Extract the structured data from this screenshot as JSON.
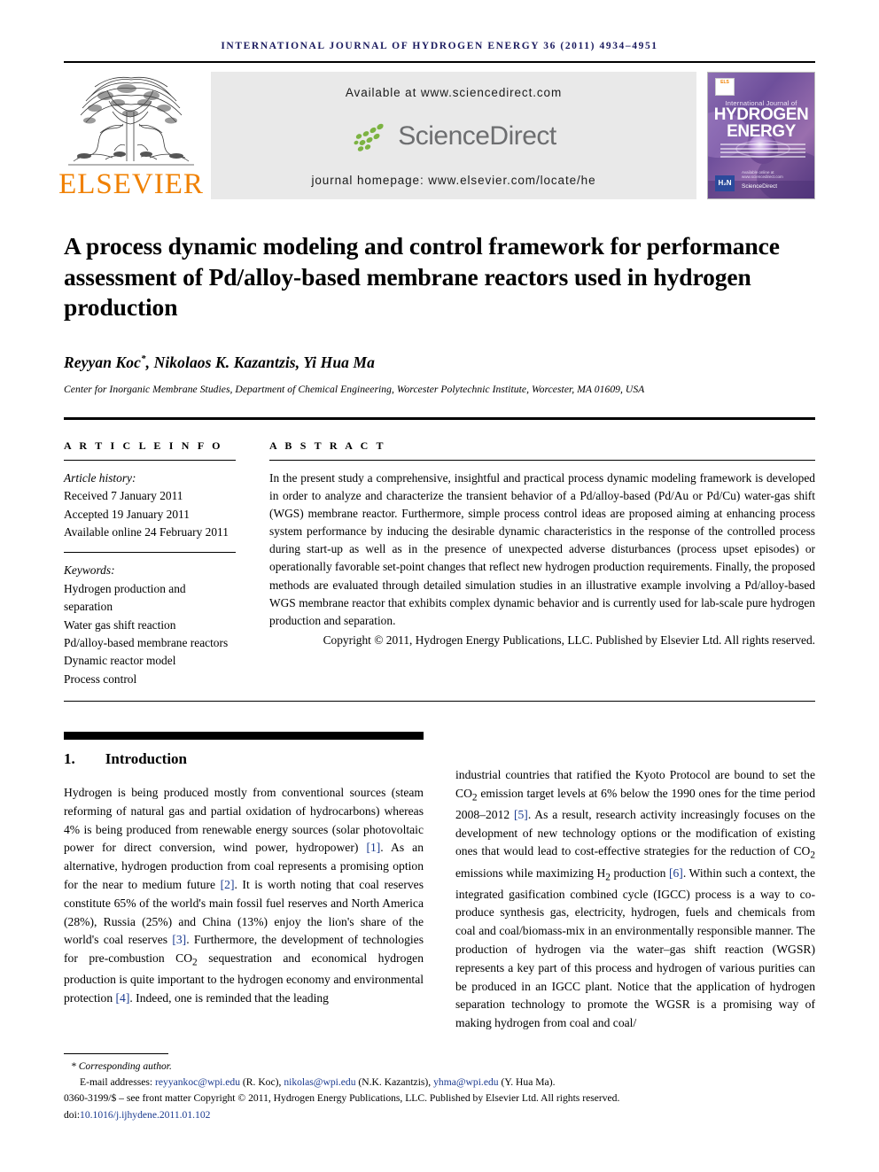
{
  "running_head": "international journal of hydrogen energy 36 (2011) 4934–4951",
  "masthead": {
    "publisher": "ELSEVIER",
    "available_at": "Available at www.sciencedirect.com",
    "sciencedirect_word": "ScienceDirect",
    "journal_homepage": "journal homepage: www.elsevier.com/locate/he",
    "cover": {
      "line_small": "International Journal of",
      "line_1": "HYDROGEN",
      "line_2": "ENERGY",
      "badge_hi": "H₂N",
      "sd_label": "ScienceDirect",
      "sd_sub": "Available online at www.sciencedirect.com"
    },
    "accent_orange": "#F08000",
    "accent_green": "#7CB342",
    "banner_bg": "#e9e9e9"
  },
  "article": {
    "title": "A process dynamic modeling and control framework for performance assessment of Pd/alloy-based membrane reactors used in hydrogen production",
    "authors": "Reyyan Koc",
    "authors_star": "*",
    "authors_rest": ", Nikolaos K. Kazantzis, Yi Hua Ma",
    "affiliation": "Center for Inorganic Membrane Studies, Department of Chemical Engineering, Worcester Polytechnic Institute, Worcester, MA 01609, USA"
  },
  "article_info": {
    "heading": "A R T I C L E   I N F O",
    "history_label": "Article history:",
    "received": "Received 7 January 2011",
    "accepted": "Accepted 19 January 2011",
    "available_online": "Available online 24 February 2011",
    "keywords_label": "Keywords:",
    "keywords": [
      "Hydrogen production and separation",
      "Water gas shift reaction",
      "Pd/alloy-based membrane reactors",
      "Dynamic reactor model",
      "Process control"
    ]
  },
  "abstract": {
    "heading": "A B S T R A C T",
    "text": "In the present study a comprehensive, insightful and practical process dynamic modeling framework is developed in order to analyze and characterize the transient behavior of a Pd/alloy-based (Pd/Au or Pd/Cu) water-gas shift (WGS) membrane reactor. Furthermore, simple process control ideas are proposed aiming at enhancing process system performance by inducing the desirable dynamic characteristics in the response of the controlled process during start-up as well as in the presence of unexpected adverse disturbances (process upset episodes) or operationally favorable set-point changes that reflect new hydrogen production requirements. Finally, the proposed methods are evaluated through detailed simulation studies in an illustrative example involving a Pd/alloy-based WGS membrane reactor that exhibits complex dynamic behavior and is currently used for lab-scale pure hydrogen production and separation.",
    "copyright": "Copyright © 2011, Hydrogen Energy Publications, LLC. Published by Elsevier Ltd. All rights reserved."
  },
  "section": {
    "number": "1.",
    "title": "Introduction"
  },
  "body": {
    "left_col_parts": [
      "Hydrogen is being produced mostly from conventional sources (steam reforming of natural gas and partial oxidation of hydrocarbons) whereas 4% is being produced from renewable energy sources (solar photovoltaic power for direct conversion, wind power, hydropower) ",
      "[1]",
      ". As an alternative, hydrogen production from coal represents a promising option for the near to medium future ",
      "[2]",
      ". It is worth noting that coal reserves constitute 65% of the world's main fossil fuel reserves and North America (28%), Russia (25%) and China (13%) enjoy the lion's share of the world's coal reserves ",
      "[3]",
      ". Furthermore, the development of technologies for pre-combustion CO2 sequestration and economical hydrogen production is quite important to the hydrogen economy and environmental protection ",
      "[4]",
      ". Indeed, one is reminded that the leading"
    ],
    "right_col_parts": [
      "industrial countries that ratified the Kyoto Protocol are bound to set the CO2 emission target levels at 6% below the 1990 ones for the time period 2008–2012 ",
      "[5]",
      ". As a result, research activity increasingly focuses on the development of new technology options or the modification of existing ones that would lead to cost-effective strategies for the reduction of CO2 emissions while maximizing H2 production ",
      "[6]",
      ". Within such a context, the integrated gasification combined cycle (IGCC) process is a way to co-produce synthesis gas, electricity, hydrogen, fuels and chemicals from coal and coal/biomass-mix in an environmentally responsible manner. The production of hydrogen via the water–gas shift reaction (WGSR) represents a key part of this process and hydrogen of various purities can be produced in an IGCC plant. Notice that the application of hydrogen separation technology to promote the WGSR is a promising way of making hydrogen from coal and coal/"
    ]
  },
  "footer": {
    "corresponding": "* Corresponding author.",
    "email_label": "E-mail addresses:",
    "emails": [
      {
        "address": "reyyankoc@wpi.edu",
        "name": "(R. Koc)"
      },
      {
        "address": "nikolas@wpi.edu",
        "name": "(N.K. Kazantzis)"
      },
      {
        "address": "yhma@wpi.edu",
        "name": "(Y. Hua Ma)"
      }
    ],
    "issn_line": "0360-3199/$ – see front matter Copyright © 2011, Hydrogen Energy Publications, LLC. Published by Elsevier Ltd. All rights reserved.",
    "doi_label": "doi:",
    "doi_value": "10.1016/j.ijhydene.2011.01.102",
    "link_color": "#1a3a8f"
  }
}
